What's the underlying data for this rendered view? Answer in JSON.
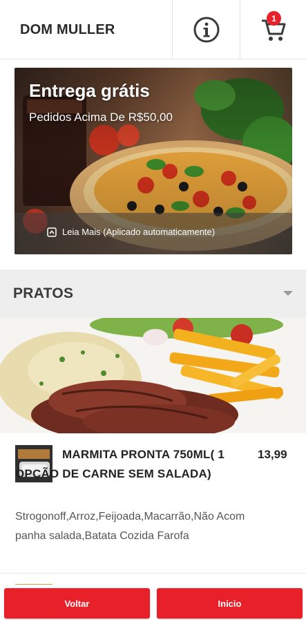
{
  "header": {
    "brand": "DOM MULLER",
    "info_icon": "info-icon",
    "cart_icon": "cart-icon",
    "cart_count": "1"
  },
  "banner": {
    "title": "Entrega grátis",
    "subtitle": "Pedidos Acima De R$50,00",
    "note": "Leia Mais (Aplicado automaticamente)",
    "note_icon": "chevron-up-icon"
  },
  "section": {
    "title": "PRATOS",
    "caret_icon": "caret-down-icon"
  },
  "item": {
    "name": "MARMITA PRONTA 750ML( 1 OPÇÃO DE CARNE SEM SALADA)",
    "price": "13,99",
    "description": "Strogonoff,Arroz,Feijoada,Macarrão,Não Acompanha salada,Batata Cozida Farofa"
  },
  "buttons": {
    "back": "Voltar",
    "home": "Inicio"
  },
  "colors": {
    "accent": "#e8202a",
    "section_bg": "#eeeeee"
  }
}
